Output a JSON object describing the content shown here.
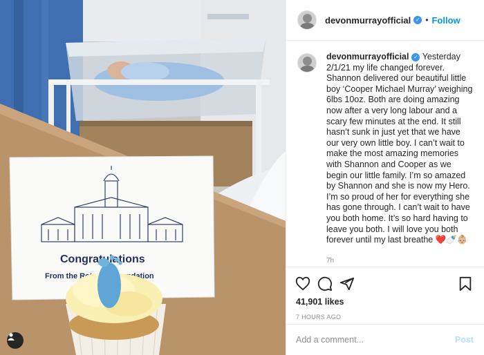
{
  "post": {
    "username": "devonmurrayofficial",
    "follow_label": "Follow",
    "separator": "•",
    "caption": "Yesterday 2/1/21 my life changed forever. Shannon delivered our beautiful little boy ‘Cooper Michael Murray’ weighing 6lbs 10oz. Both are doing amazing now after a very long labour and a scary few minutes at the end. It still hasn’t sunk in just yet that we have our very own little boy. I can’t wait to make the most amazing memories with Shannon and Cooper as we begin our little family. I’m so amazed by Shannon and she is now my Hero. I’m so proud of her for everything she has gone through. I can’t wait to have you both home. It’s so hard having to leave you both. I will love you both forever until my last breathe",
    "caption_emoji": "❤️🍼👶🏼",
    "time_ago": "7h",
    "likes": "41,901 likes",
    "date": "7 HOURS AGO",
    "comment_placeholder": "Add a comment...",
    "post_label": "Post"
  },
  "photo": {
    "card_line1": "Congratulations",
    "card_line2": "From the Rotunda Foundation"
  },
  "icons": [
    "user-tag-icon",
    "verified-badge-icon",
    "heart-icon",
    "comment-icon",
    "share-icon",
    "bookmark-icon"
  ],
  "colors": {
    "link_blue": "#0095f6",
    "verified_blue": "#3897f0",
    "muted": "#8e8e8e",
    "card_navy": "#1f2f5a"
  }
}
